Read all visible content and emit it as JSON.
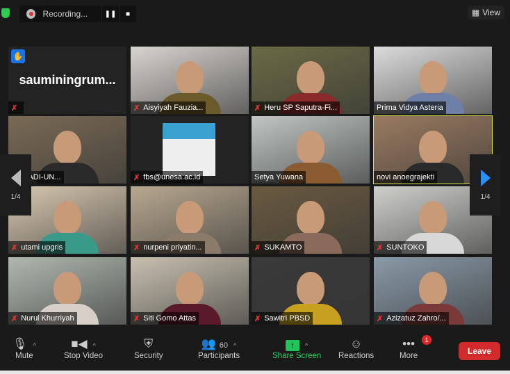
{
  "top": {
    "recording_label": "Recording...",
    "pause_icon": "pause-icon",
    "stop_icon": "stop-icon",
    "view_label": "View"
  },
  "tiles": [
    {
      "name": "sauminingrum...",
      "muted": true,
      "video": false,
      "hand": true
    },
    {
      "name": "Aisyiyah Fauzia...",
      "muted": true,
      "video": true,
      "bg": "#d8d4cf",
      "shirt": "#6b5a2a"
    },
    {
      "name": "Heru SP Saputra-Fi...",
      "muted": true,
      "video": true,
      "bg": "#6b6a45",
      "shirt": "#8a2a2a"
    },
    {
      "name": "Prima Vidya Asteria",
      "muted": false,
      "video": true,
      "bg": "#dcdcdc",
      "shirt": "#6e7fa8"
    },
    {
      "name": "AHMADI-UN...",
      "muted": false,
      "video": true,
      "bg": "#7a6a55",
      "shirt": "#2a2a2a"
    },
    {
      "name": "fbs@unesa.ac.id",
      "muted": true,
      "video": true,
      "screen": true,
      "bg": "#232323",
      "shirt": "#333"
    },
    {
      "name": "Setya Yuwana",
      "muted": false,
      "video": true,
      "bg": "#bfc6c4",
      "shirt": "#8a5a30"
    },
    {
      "name": "novi anoegrajekti",
      "muted": false,
      "video": true,
      "active": true,
      "bg": "#9a7a60",
      "shirt": "#2a2a2a"
    },
    {
      "name": "utami upgris",
      "muted": true,
      "video": true,
      "bg": "#d8c8b0",
      "shirt": "#3a9a8a"
    },
    {
      "name": "nurpeni priyatin...",
      "muted": true,
      "video": true,
      "bg": "#b8a890",
      "shirt": "#8a7a6a"
    },
    {
      "name": "SUKAMTO",
      "muted": true,
      "video": true,
      "bg": "#6a5a40",
      "shirt": "#8a6a5a"
    },
    {
      "name": "SUNTOKO",
      "muted": true,
      "video": true,
      "bg": "#cfcfcc",
      "shirt": "#d8d8d8"
    },
    {
      "name": "Nurul Khurriyah",
      "muted": true,
      "video": true,
      "bg": "#b0b8b0",
      "shirt": "#d8d0c8"
    },
    {
      "name": "Siti Gomo Attas",
      "muted": true,
      "video": true,
      "bg": "#c8c0b0",
      "shirt": "#5a1a2a"
    },
    {
      "name": "Sawitri PBSD",
      "muted": true,
      "video": true,
      "bg": "#3a3a3a",
      "shirt": "#c8a020"
    },
    {
      "name": "Azizatuz Zahro/...",
      "muted": true,
      "video": true,
      "bg": "#8a9aa8",
      "shirt": "#7a3a3a"
    }
  ],
  "pager": {
    "left": "1/4",
    "right": "1/4"
  },
  "toolbar": {
    "mute": "Mute",
    "stop_video": "Stop Video",
    "security": "Security",
    "participants": "Participants",
    "participants_count": "60",
    "share_screen": "Share Screen",
    "reactions": "Reactions",
    "more": "More",
    "more_badge": "1",
    "leave": "Leave"
  },
  "colors": {
    "share": "#1fc45a",
    "leave": "#d12b2b",
    "active_border": "#d6e34a",
    "pager_arrow": "#2a8ff7"
  }
}
